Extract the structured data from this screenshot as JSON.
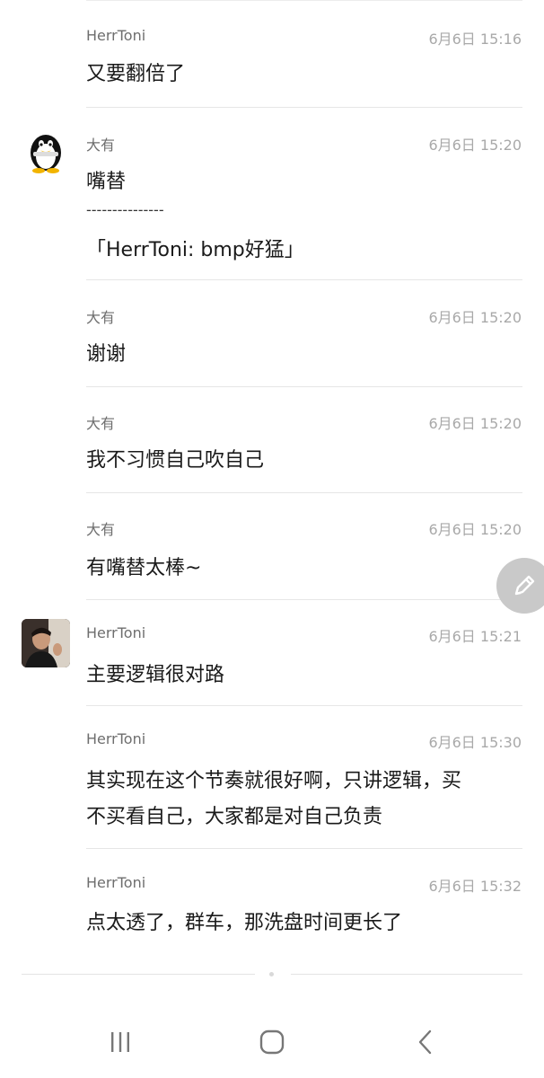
{
  "messages": [
    {
      "sender": "HerrToni",
      "time": "6月6日 15:16",
      "lines": [
        "又要翻倍了"
      ]
    },
    {
      "sender": "大有",
      "time": "6月6日 15:20",
      "lines": [
        "嘴替"
      ],
      "separator": "---------------",
      "quote": "「HerrToni: bmp好猛」",
      "avatar": "qq-penguin-avatar"
    },
    {
      "sender": "大有",
      "time": "6月6日 15:20",
      "lines": [
        "谢谢"
      ]
    },
    {
      "sender": "大有",
      "time": "6月6日 15:20",
      "lines": [
        "我不习惯自己吹自己"
      ]
    },
    {
      "sender": "大有",
      "time": "6月6日 15:20",
      "lines": [
        "有嘴替太棒~"
      ]
    },
    {
      "sender": "HerrToni",
      "time": "6月6日 15:21",
      "lines": [
        "主要逻辑很对路"
      ],
      "avatar": "user-photo-avatar"
    },
    {
      "sender": "HerrToni",
      "time": "6月6日 15:30",
      "lines": [
        "其实现在这个节奏就很好啊，只讲逻辑，买",
        "不买看自己，大家都是对自己负责"
      ]
    },
    {
      "sender": "HerrToni",
      "time": "6月6日 15:32",
      "lines": [
        "点太透了，群车，那洗盘时间更长了"
      ]
    }
  ],
  "fab": {
    "icon": "pencil-icon"
  },
  "navbar": {
    "icons": [
      "recent-apps-icon",
      "home-icon",
      "back-icon"
    ]
  },
  "colors": {
    "name": "#6e6e6e",
    "time": "#a9a9a9",
    "text": "#1a1a1a",
    "divider": "#e6e6e6",
    "fab": "#c9c9c9"
  }
}
